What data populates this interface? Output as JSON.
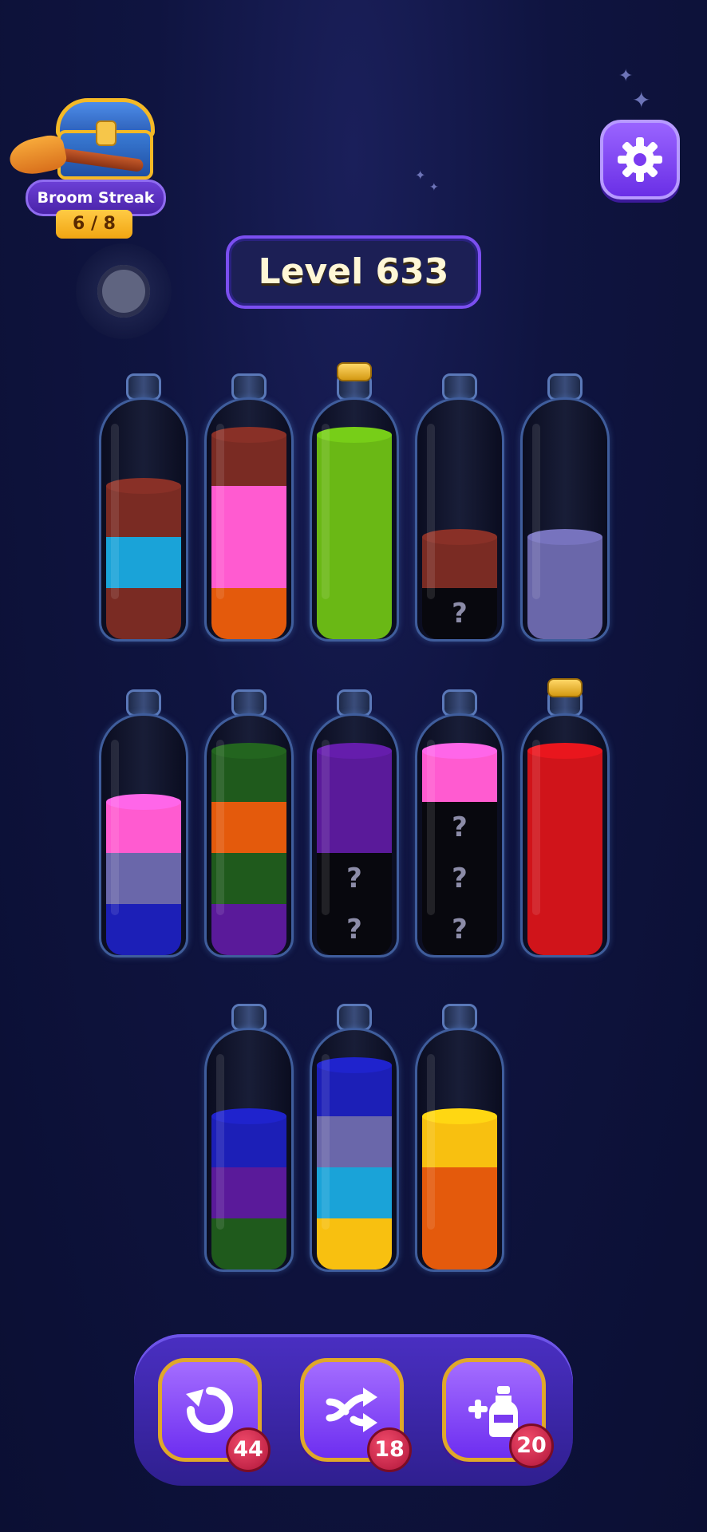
{
  "streak": {
    "title": "Broom Streak",
    "count": "6 / 8",
    "icon": "treasure-chest-icon"
  },
  "level": {
    "label": "Level 633"
  },
  "settings": {
    "icon": "gear-icon"
  },
  "colors": {
    "maroon": "#7a2b23",
    "cyan": "#1aa3d8",
    "pink": "#ff5bd0",
    "orange": "#e45a0c",
    "lime": "#6ab815",
    "lavender": "#6a67aa",
    "navy": "#1c1fb7",
    "forest": "#1f5a1c",
    "purple": "#5a1a9a",
    "red": "#d0141a",
    "yellow": "#f8c010",
    "hidden": "#08080e"
  },
  "bottles": [
    {
      "id": 1,
      "sealed": false,
      "layers": [
        "maroon",
        "cyan",
        "maroon"
      ]
    },
    {
      "id": 2,
      "sealed": false,
      "layers": [
        "orange",
        "pink",
        "pink",
        "maroon"
      ]
    },
    {
      "id": 3,
      "sealed": true,
      "layers": [
        "lime",
        "lime",
        "lime",
        "lime"
      ]
    },
    {
      "id": 4,
      "sealed": false,
      "layers": [
        "hidden",
        "maroon"
      ]
    },
    {
      "id": 5,
      "sealed": false,
      "layers": [
        "lavender",
        "lavender"
      ]
    },
    {
      "id": 6,
      "sealed": false,
      "layers": [
        "navy",
        "lavender",
        "pink"
      ]
    },
    {
      "id": 7,
      "sealed": false,
      "layers": [
        "purple",
        "forest",
        "orange",
        "forest"
      ]
    },
    {
      "id": 8,
      "sealed": false,
      "layers": [
        "hidden",
        "hidden",
        "purple",
        "purple"
      ]
    },
    {
      "id": 9,
      "sealed": false,
      "layers": [
        "hidden",
        "hidden",
        "hidden",
        "pink"
      ]
    },
    {
      "id": 10,
      "sealed": true,
      "layers": [
        "red",
        "red",
        "red",
        "red"
      ]
    },
    {
      "id": 11,
      "sealed": false,
      "layers": [
        "forest",
        "purple",
        "navy"
      ]
    },
    {
      "id": 12,
      "sealed": false,
      "layers": [
        "yellow",
        "cyan",
        "lavender",
        "navy"
      ]
    },
    {
      "id": 13,
      "sealed": false,
      "layers": [
        "orange",
        "orange",
        "yellow"
      ]
    }
  ],
  "hidden_marker": "?",
  "toolbar": {
    "undo": {
      "icon": "undo-icon",
      "count": "44"
    },
    "shuffle": {
      "icon": "shuffle-icon",
      "count": "18"
    },
    "add_bottle": {
      "icon": "add-bottle-icon",
      "count": "20"
    }
  }
}
